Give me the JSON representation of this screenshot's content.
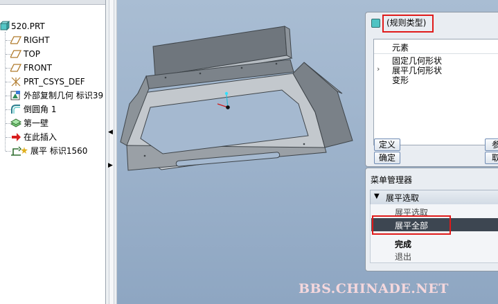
{
  "model_tree": {
    "items": [
      {
        "label": "520.PRT",
        "icon": "part-icon"
      },
      {
        "label": "RIGHT",
        "icon": "datum-plane-icon"
      },
      {
        "label": "TOP",
        "icon": "datum-plane-icon"
      },
      {
        "label": "FRONT",
        "icon": "datum-plane-icon"
      },
      {
        "label": "PRT_CSYS_DEF",
        "icon": "csys-icon"
      },
      {
        "label": "外部复制几何 标识39",
        "icon": "external-copy-geom-icon"
      },
      {
        "label": "倒圆角 1",
        "icon": "round-icon"
      },
      {
        "label": "第一壁",
        "icon": "first-wall-icon"
      },
      {
        "label": "在此插入",
        "icon": "insert-here-arrow-icon"
      },
      {
        "label": "展平 标识1560",
        "icon": "unbend-icon"
      }
    ]
  },
  "relations_dialog": {
    "title": "(规则类型)",
    "column_header": "元素",
    "elements": [
      {
        "label": "固定几何形状",
        "expander": ""
      },
      {
        "label": "展平几何形状",
        "expander": "›"
      },
      {
        "label": "变形",
        "expander": ""
      }
    ],
    "buttons": {
      "define": "定义",
      "ok": "确定",
      "refs": "参",
      "cancel": "取"
    }
  },
  "menu_manager": {
    "title": "菜单管理器",
    "section_label": "展平选取",
    "items": [
      "展平选取",
      "展平全部"
    ],
    "selected_item": "展平全部",
    "done": "完成",
    "exit": "退出"
  },
  "watermark": "BBS.CHINADE.NET",
  "colors": {
    "highlight_box": "#e01a1a",
    "selected_row": "#3d4651",
    "viewport": "#a0b6cf"
  }
}
